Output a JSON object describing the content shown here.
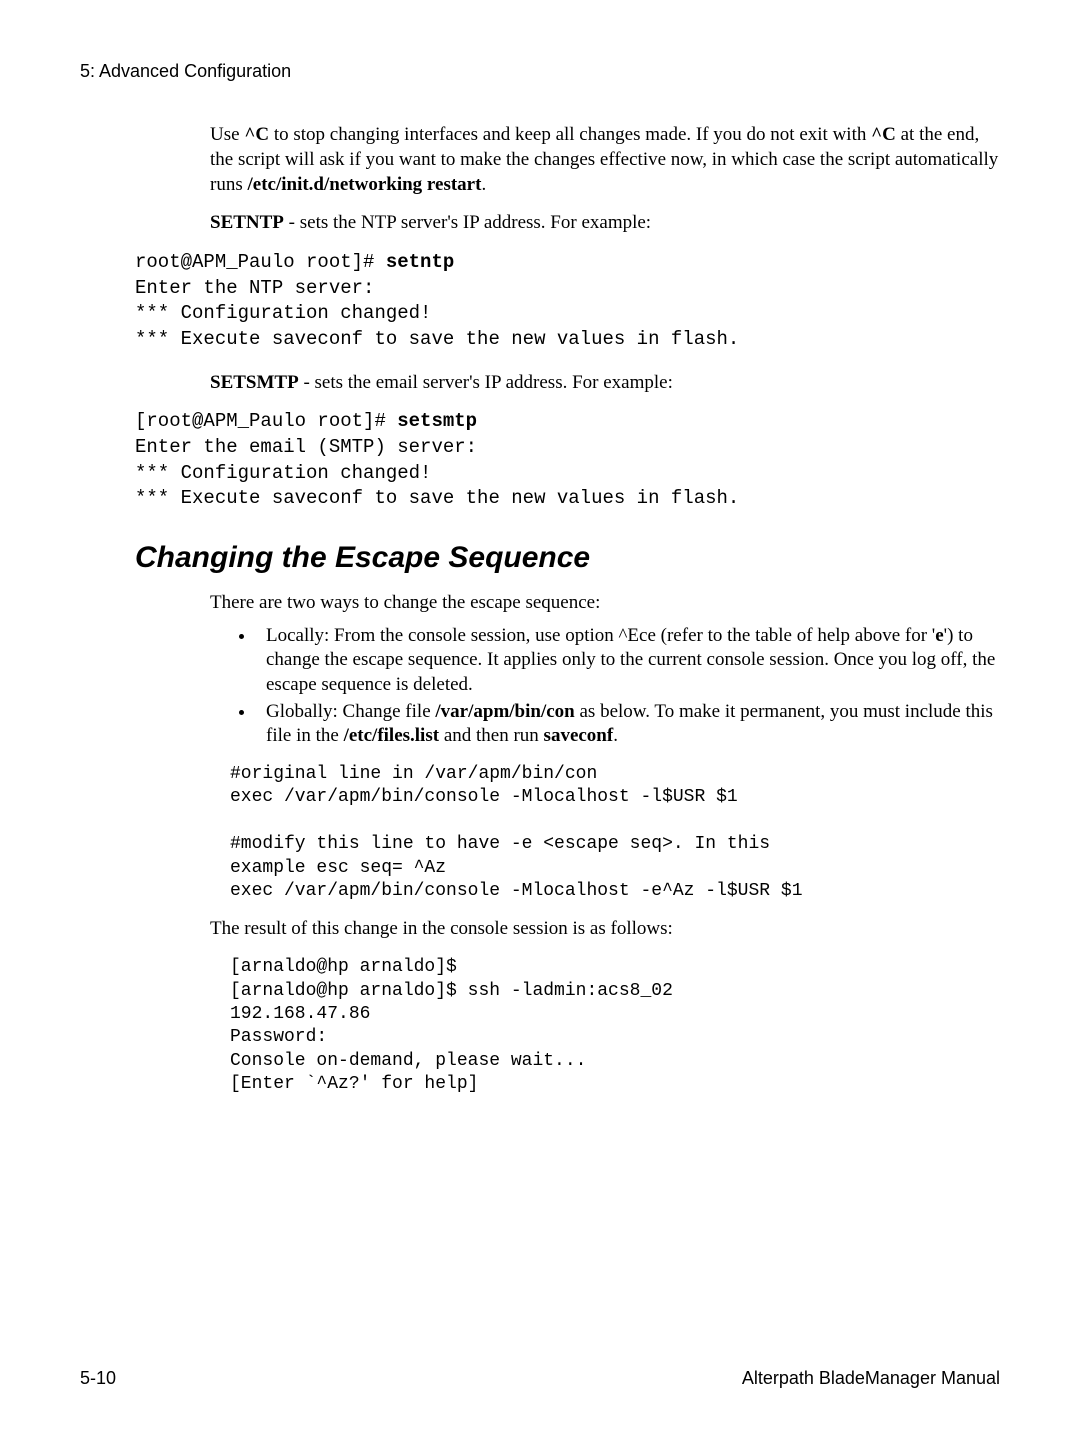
{
  "header": "5: Advanced Configuration",
  "para1_pre": "Use ",
  "para1_b1": "^C",
  "para1_mid": " to stop changing interfaces and keep all changes made. If you do not exit with ",
  "para1_b2": "^C",
  "para1_mid2": " at the end, the script will ask if you want to make the changes effective now, in which case the script automatically runs ",
  "para1_b3": "/etc/init.d/networking restart",
  "para1_end": ".",
  "setntp_b": "SETNTP",
  "setntp_rest": " - sets the NTP server's IP address. For example:",
  "code1_line1_pre": "root@APM_Paulo root]# ",
  "code1_line1_cmd": "setntp",
  "code1_rest": "Enter the NTP server:\n*** Configuration changed!\n*** Execute saveconf to save the new values in flash.",
  "setsmtp_b": "SETSMTP",
  "setsmtp_rest": " - sets the email server's IP address. For example:",
  "code2_line1_pre": "[root@APM_Paulo root]# ",
  "code2_line1_cmd": "setsmtp",
  "code2_rest": "Enter the email (SMTP) server:\n*** Configuration changed!\n*** Execute saveconf to save the new values in flash.",
  "h2": "Changing the Escape Sequence",
  "para2": "There are two ways to change the escape sequence:",
  "li1_pre": "Locally: From the console session, use option ^Ece (refer to the table of help above for '",
  "li1_b": "e",
  "li1_post": "') to change the escape sequence. It applies only to the current console session. Once you log off, the escape sequence is deleted.",
  "li2_pre": "Globally: Change file ",
  "li2_b1": "/var/apm/bin/con",
  "li2_mid": " as below. To make it permanent, you must include this file in the ",
  "li2_b2": "/etc/files.list",
  "li2_mid2": " and then run ",
  "li2_b3": "saveconf",
  "li2_end": ".",
  "code3": "#original line in /var/apm/bin/con\nexec /var/apm/bin/console -Mlocalhost -l$USR $1\n\n#modify this line to have -e <escape seq>. In this\nexample esc seq= ^Az\nexec /var/apm/bin/console -Mlocalhost -e^Az -l$USR $1",
  "para3": "The result of this change in the console session is as follows:",
  "code4": "[arnaldo@hp arnaldo]$\n[arnaldo@hp arnaldo]$ ssh -ladmin:acs8_02\n192.168.47.86\nPassword:\nConsole on-demand, please wait...\n[Enter `^Az?' for help]",
  "footer_left": "5-10",
  "footer_right": "Alterpath BladeManager Manual"
}
